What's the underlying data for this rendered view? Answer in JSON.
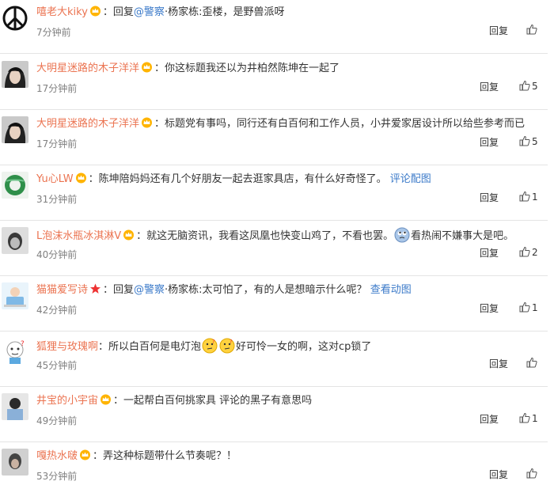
{
  "comments": [
    {
      "user": "嘻老大kiky",
      "vip": true,
      "pre": "：回复",
      "mention": "@警察",
      "text": "·杨家栋:歪楼，是野兽派呀",
      "time": "7分钟前",
      "reply": "回复",
      "likes": ""
    },
    {
      "user": "大明星迷路的木子洋洋",
      "vip": true,
      "text": "：你这标题我还以为井柏然陈坤在一起了",
      "time": "17分钟前",
      "reply": "回复",
      "likes": "5"
    },
    {
      "user": "大明星迷路的木子洋洋",
      "vip": true,
      "text": "：标题党有事吗，同行还有白百何和工作人员，小井爱家居设计所以给些参考而已",
      "time": "17分钟前",
      "reply": "回复",
      "likes": "5"
    },
    {
      "user": "Yu心LW",
      "vip": true,
      "text": "：陈坤陪妈妈还有几个好朋友一起去逛家具店，有什么好奇怪了。",
      "extra": "评论配图",
      "time": "31分钟前",
      "reply": "回复",
      "likes": "1"
    },
    {
      "user": "L泡沫水瓶冰淇淋V",
      "vip": true,
      "text": "：就这无脑资讯，我看这凤凰也快变山鸡了，不看也罢。",
      "text2": "看热闹不嫌事大是吧。",
      "time": "40分钟前",
      "reply": "回复",
      "likes": "2"
    },
    {
      "user": "猫猫爱写诗",
      "vip": false,
      "star": true,
      "pre": "：回复",
      "mention": "@警察",
      "text": "·杨家栋:太可怕了，有的人是想暗示什么呢？",
      "extra": "查看动图",
      "time": "42分钟前",
      "reply": "回复",
      "likes": "1"
    },
    {
      "user": "狐狸与玫瑰啊",
      "vip": false,
      "text": "：所以白百何是电灯泡",
      "text2": "好可怜一女的啊，这对cp锁了",
      "time": "45分钟前",
      "reply": "回复",
      "likes": ""
    },
    {
      "user": "井宝的小宇宙",
      "vip": true,
      "text": "：一起帮白百何挑家具 评论的黑子有意思吗",
      "time": "49分钟前",
      "reply": "回复",
      "likes": "1"
    },
    {
      "user": "嘎热水啵",
      "vip": true,
      "text": "：弄这种标题带什么节奏呢？！",
      "time": "53分钟前",
      "reply": "回复",
      "likes": ""
    }
  ],
  "colors": {
    "username": "#eb7350",
    "link": "#3b7ac9",
    "time": "#808080",
    "separator": "#e4e4e4"
  }
}
